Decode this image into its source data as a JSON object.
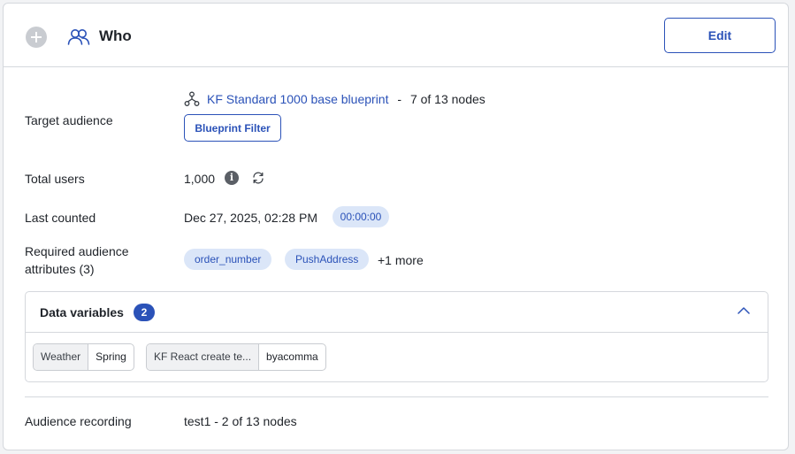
{
  "header": {
    "title": "Who",
    "edit_label": "Edit",
    "add_icon": "plus-circle-icon",
    "who_icon": "users-icon"
  },
  "target_audience": {
    "label": "Target audience",
    "icon": "blueprint-tree-icon",
    "blueprint_name": "KF Standard 1000 base blueprint",
    "separator": "-",
    "node_info": "7 of 13 nodes",
    "filter_button": "Blueprint Filter"
  },
  "total_users": {
    "label": "Total users",
    "value": "1,000",
    "info_glyph": "i",
    "info_icon": "info-icon",
    "refresh_icon": "refresh-icon"
  },
  "last_counted": {
    "label": "Last counted",
    "value": "Dec 27, 2025, 02:28 PM",
    "timer": "00:00:00"
  },
  "required_attributes": {
    "label_line1": "Required audience",
    "label_line2": "attributes (3)",
    "pills": [
      "order_number",
      "PushAddress"
    ],
    "more": "+1 more"
  },
  "data_variables": {
    "title": "Data variables",
    "count": "2",
    "collapse_icon": "chevron-up-icon",
    "chips": [
      {
        "key": "Weather",
        "value": "Spring"
      },
      {
        "key": "KF React create te...",
        "value": "byacomma"
      }
    ]
  },
  "audience_recording": {
    "label": "Audience recording",
    "value": "test1 - 2 of 13 nodes"
  },
  "colors": {
    "accent": "#2b52b8",
    "pill_bg": "#dbe6f8",
    "border": "#d5d8dd"
  }
}
